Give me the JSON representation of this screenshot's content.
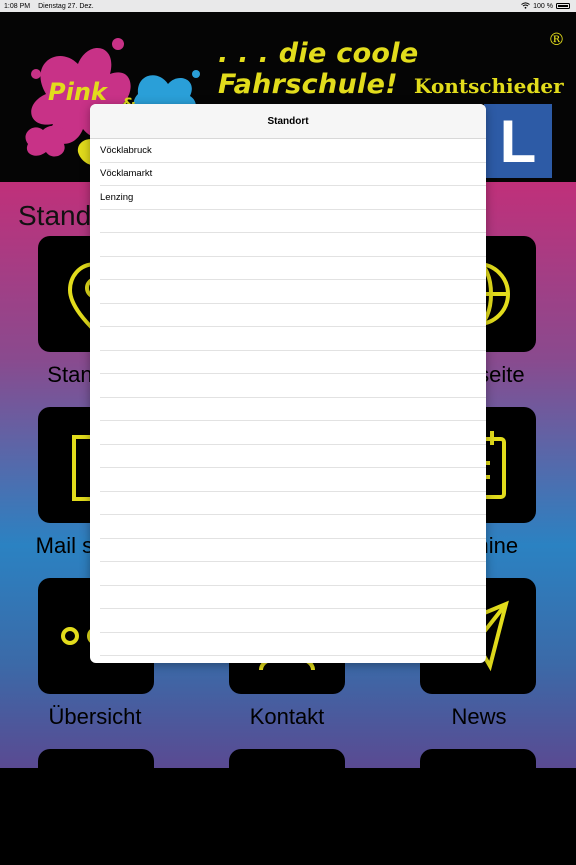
{
  "status_bar": {
    "time": "1:08 PM",
    "date": "Dienstag 27. Dez.",
    "battery": "100 %"
  },
  "banner": {
    "tagline": ". . . die coole Fahrschule!",
    "registered": "®",
    "name": "Kontschieder",
    "pink": "Pink",
    "amp": "&",
    "sign_letter": "L"
  },
  "main": {
    "section_title": "Standorte",
    "tiles": [
      {
        "label": "Standorte",
        "icon": "location-pin-icon"
      },
      {
        "label": "Webseite",
        "icon": "globe-icon"
      },
      {
        "label": "Mail senden",
        "icon": "document-icon"
      },
      {
        "label": "Termine",
        "icon": "calendar-icon"
      },
      {
        "label": "Übersicht",
        "icon": "dots-icon"
      },
      {
        "label": "Kontakt",
        "icon": "contact-icon"
      },
      {
        "label": "News",
        "icon": "send-icon"
      }
    ]
  },
  "modal": {
    "title": "Standort",
    "options": [
      "Vöcklabruck",
      "Vöcklamarkt",
      "Lenzing"
    ]
  },
  "colors": {
    "accent_yellow": "#e2dc1c",
    "gradient_top": "#c0307a",
    "gradient_mid": "#2b82c2",
    "sign_blue": "#2d5ba6"
  }
}
